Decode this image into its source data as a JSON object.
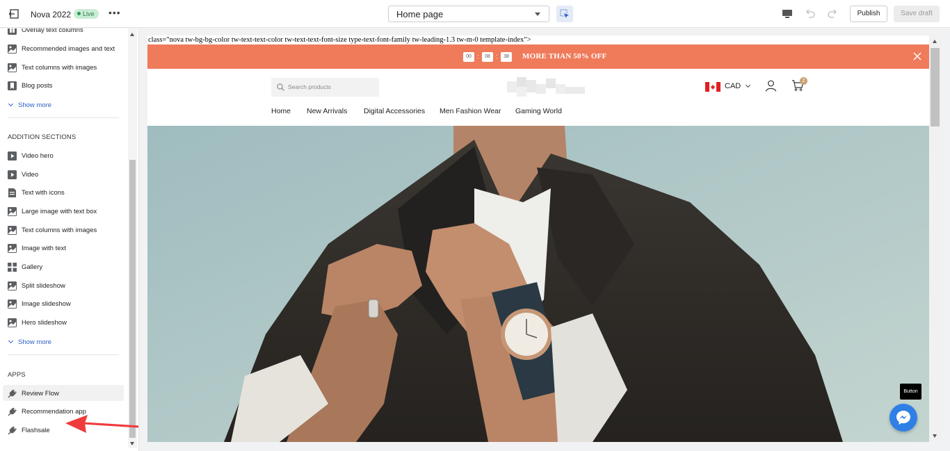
{
  "topbar": {
    "theme_name": "Nova 2022",
    "live_badge": "Live",
    "more_label": "•••",
    "page_select_value": "Home page",
    "publish_label": "Publish",
    "save_draft_label": "Save draft"
  },
  "sidebar": {
    "items_top": [
      {
        "label": "Overlay text columns",
        "icon": "columns-icon"
      },
      {
        "label": "Recommended images and text",
        "icon": "image-icon"
      },
      {
        "label": "Text columns with images",
        "icon": "image-icon"
      },
      {
        "label": "Blog posts",
        "icon": "blog-icon"
      }
    ],
    "show_more_1": "Show more",
    "addition_heading": "ADDITION SECTIONS",
    "addition_items": [
      {
        "label": "Video hero",
        "icon": "video-icon"
      },
      {
        "label": "Video",
        "icon": "video-icon"
      },
      {
        "label": "Text with icons",
        "icon": "text-icon"
      },
      {
        "label": "Large image with text box",
        "icon": "image-icon"
      },
      {
        "label": "Text columns with images",
        "icon": "image-icon"
      },
      {
        "label": "Image with text",
        "icon": "image-icon"
      },
      {
        "label": "Gallery",
        "icon": "gallery-icon"
      },
      {
        "label": "Split slideshow",
        "icon": "image-icon"
      },
      {
        "label": "Image slideshow",
        "icon": "image-icon"
      },
      {
        "label": "Hero slideshow",
        "icon": "image-icon"
      }
    ],
    "show_more_2": "Show more",
    "apps_heading": "APPS",
    "app_items": [
      {
        "label": "Review Flow",
        "icon": "plug-icon"
      },
      {
        "label": "Recommendation app",
        "icon": "plug-icon"
      },
      {
        "label": "Flashsale",
        "icon": "plug-icon"
      }
    ]
  },
  "preview": {
    "code_leak": "class=\"nova tw-bg-bg-color tw-text-text-color tw-text-text-font-size type-text-font-family tw-leading-1.3 tw-m-0 template-index\">",
    "timer": {
      "h": "00",
      "m": "08",
      "s": "38"
    },
    "promo_text": "MORE THAN 50% OFF",
    "search_placeholder": "Search products",
    "currency": "CAD",
    "cart_count": "2",
    "nav": [
      "Home",
      "New Arrivals",
      "Digital Accessories",
      "Men Fashion Wear",
      "Gaming World"
    ],
    "tooltip": "Button"
  },
  "colors": {
    "promo_bar": "#ef7b5b",
    "link_blue": "#2c5fc7",
    "annotation_arrow": "#ef3b3b",
    "messenger": "#2e7fe6"
  }
}
